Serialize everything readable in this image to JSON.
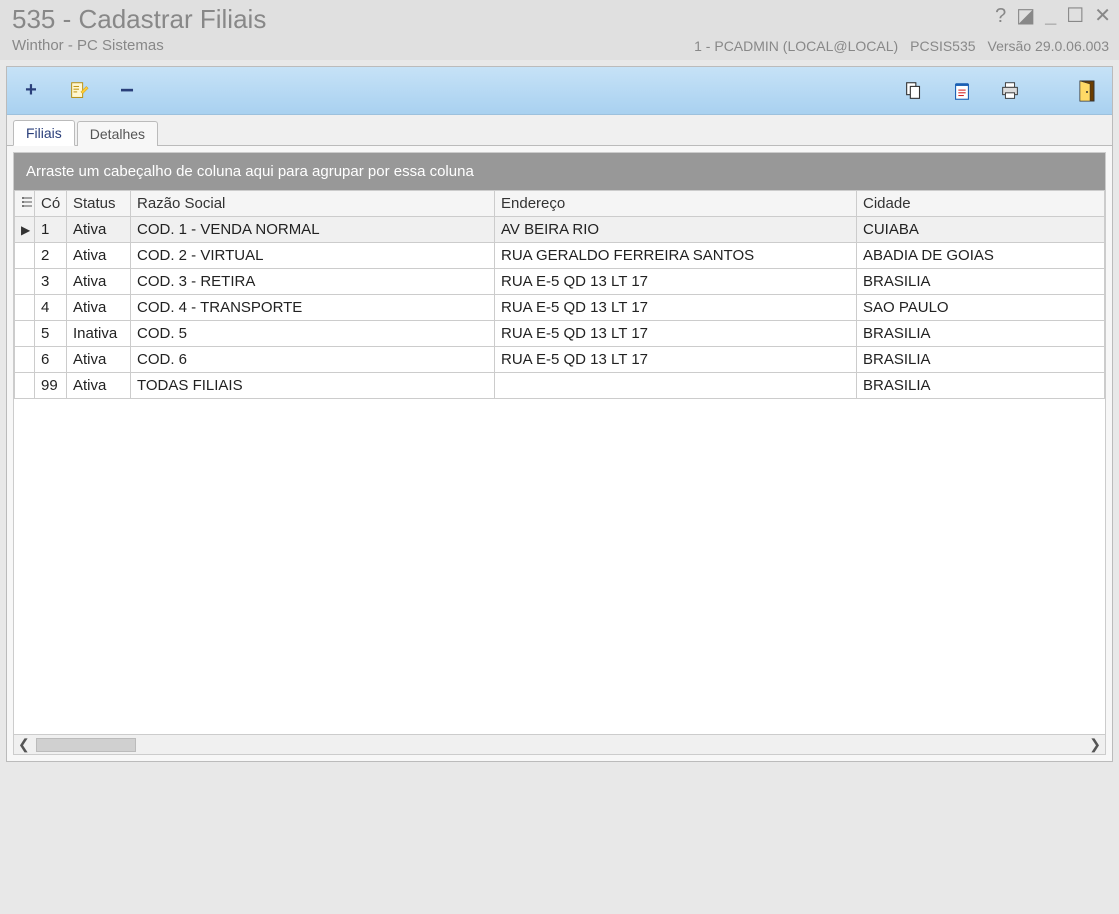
{
  "window": {
    "title": "535 - Cadastrar Filiais",
    "subtitle": "Winthor - PC Sistemas",
    "user_info": "1 - PCADMIN (LOCAL@LOCAL)",
    "module": "PCSIS535",
    "version_label": "Versão",
    "version": "29.0.06.003"
  },
  "tabs": [
    {
      "label": "Filiais",
      "active": true
    },
    {
      "label": "Detalhes",
      "active": false
    }
  ],
  "group_hint": "Arraste um cabeçalho de coluna aqui para agrupar por essa coluna",
  "columns": {
    "cod": "Có",
    "status": "Status",
    "razao": "Razão Social",
    "endereco": "Endereço",
    "cidade": "Cidade"
  },
  "rows": [
    {
      "selected": true,
      "cod": "1",
      "status": "Ativa",
      "razao": "COD. 1 - VENDA NORMAL",
      "endereco": "AV BEIRA RIO",
      "cidade": "CUIABA"
    },
    {
      "selected": false,
      "cod": "2",
      "status": "Ativa",
      "razao": "COD. 2 - VIRTUAL",
      "endereco": "RUA GERALDO FERREIRA SANTOS",
      "cidade": "ABADIA DE GOIAS"
    },
    {
      "selected": false,
      "cod": "3",
      "status": "Ativa",
      "razao": "COD. 3 - RETIRA",
      "endereco": "RUA E-5 QD 13 LT 17",
      "cidade": "BRASILIA"
    },
    {
      "selected": false,
      "cod": "4",
      "status": "Ativa",
      "razao": "COD. 4 - TRANSPORTE",
      "endereco": "RUA E-5 QD 13 LT 17",
      "cidade": "SAO PAULO"
    },
    {
      "selected": false,
      "cod": "5",
      "status": "Inativa",
      "razao": "COD. 5",
      "endereco": "RUA E-5 QD 13 LT 17",
      "cidade": "BRASILIA"
    },
    {
      "selected": false,
      "cod": "6",
      "status": "Ativa",
      "razao": "COD. 6",
      "endereco": "RUA E-5 QD 13 LT 17",
      "cidade": "BRASILIA"
    },
    {
      "selected": false,
      "cod": "99",
      "status": "Ativa",
      "razao": "TODAS FILIAIS",
      "endereco": "",
      "cidade": "BRASILIA"
    }
  ]
}
